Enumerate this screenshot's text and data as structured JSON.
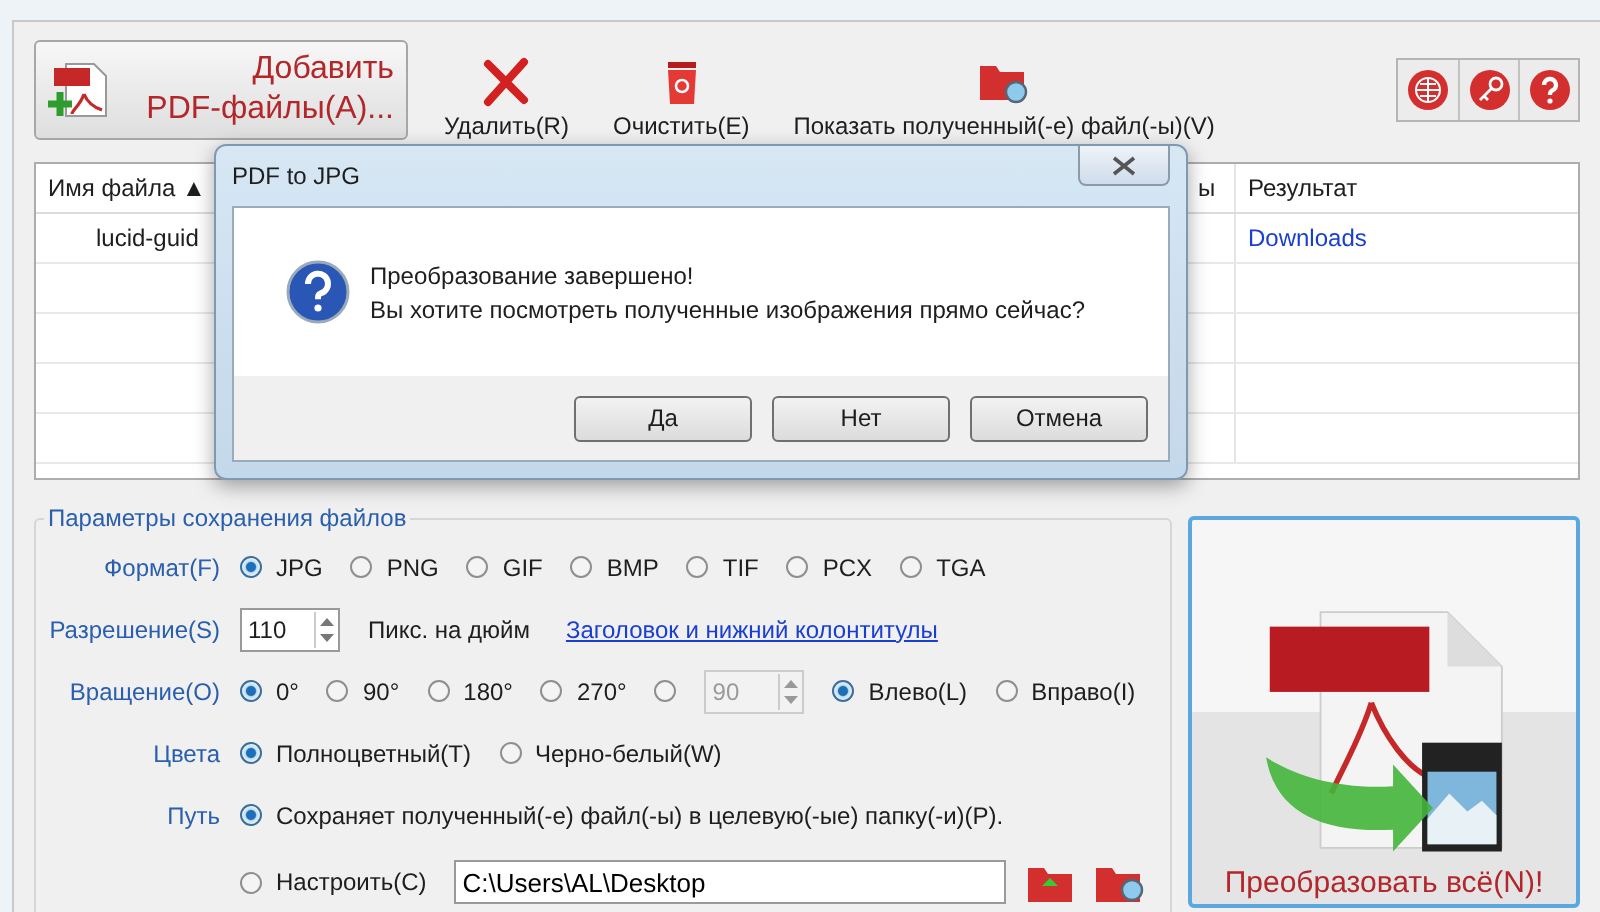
{
  "toolbar": {
    "add_button": {
      "line_1": "Добавить",
      "line_2": "PDF-файлы(A)..."
    },
    "buttons": [
      {
        "kind": "delete",
        "label": "Удалить(R)"
      },
      {
        "kind": "clear",
        "label": "Очистить(E)"
      },
      {
        "kind": "show",
        "label": "Показать полученный(-е) файл(-ы)(V)"
      }
    ],
    "icon_buttons": [
      {
        "kind": "web"
      },
      {
        "kind": "key"
      },
      {
        "kind": "help"
      }
    ]
  },
  "file_table": {
    "columns": [
      "Имя файла ▲",
      "ы",
      "Результат"
    ],
    "rows": [
      {
        "name": "lucid-guid",
        "column_2": "",
        "result": "Downloads"
      }
    ]
  },
  "settings": {
    "title": "Параметры сохранения файлов",
    "format": {
      "label": "Формат(F)",
      "options": [
        {
          "label": "JPG",
          "selected": true
        },
        {
          "label": "PNG",
          "selected": false
        },
        {
          "label": "GIF",
          "selected": false
        },
        {
          "label": "BMP",
          "selected": false
        },
        {
          "label": "TIF",
          "selected": false
        },
        {
          "label": "PCX",
          "selected": false
        },
        {
          "label": "TGA",
          "selected": false
        }
      ]
    },
    "resolution": {
      "label": "Разрешение(S)",
      "value": "110",
      "unit": "Пикс. на дюйм",
      "link": "Заголовок и нижний колонтитулы"
    },
    "rotation": {
      "label": "Вращение(O)",
      "options": [
        {
          "label": "0°",
          "selected": true
        },
        {
          "label": "90°",
          "selected": false
        },
        {
          "label": "180°",
          "selected": false
        },
        {
          "label": "270°",
          "selected": false
        }
      ],
      "custom": {
        "selected": false,
        "value": "90",
        "disabled": true
      },
      "direction": [
        {
          "label": "Влево(L)",
          "selected": true
        },
        {
          "label": "Вправо(I)",
          "selected": false
        }
      ]
    },
    "colors": {
      "label": "Цвета",
      "options": [
        {
          "label": "Полноцветный(T)",
          "selected": true
        },
        {
          "label": "Черно-белый(W)",
          "selected": false
        }
      ]
    },
    "path": {
      "label": "Путь",
      "options": [
        {
          "label": "Сохраняет полученный(-е) файл(-ы) в целевую(-ые) папку(-и)(P).",
          "selected": true
        },
        {
          "label": "Настроить(C)",
          "selected": false
        }
      ],
      "value": "C:\\Users\\AL\\Desktop"
    }
  },
  "convert_button": {
    "label": "Преобразовать всё(N)!"
  },
  "dialog": {
    "title": "PDF to JPG",
    "message_1": "Преобразование завершено!",
    "message_2": "Вы хотите посмотреть полученные изображения прямо сейчас?",
    "buttons": [
      "Да",
      "Нет",
      "Отмена"
    ]
  }
}
